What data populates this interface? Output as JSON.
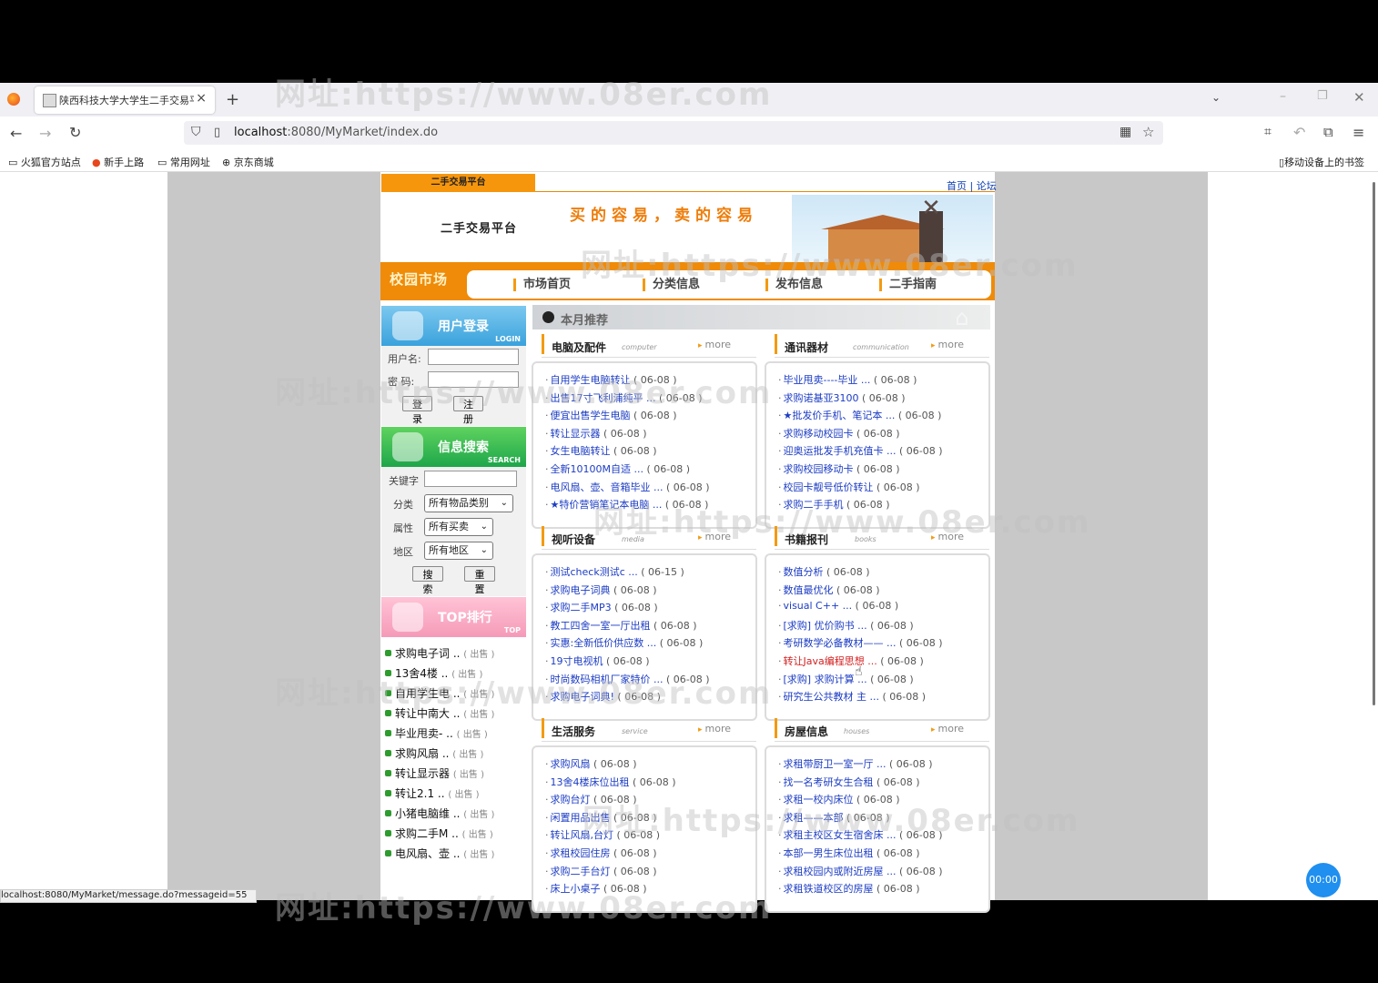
{
  "browser": {
    "tab_title": "陕西科技大学大学生二手交易平",
    "url_host": "localhost",
    "url_rest": ":8080/MyMarket/index.do",
    "bookmarks": [
      "火狐官方站点",
      "新手上路",
      "常用网址",
      "京东商城"
    ],
    "mobile_bookmarks": "移动设备上的书签",
    "status_url": "localhost:8080/MyMarket/message.do?messageid=55",
    "timer": "00:00"
  },
  "header": {
    "platform_tab": "二手交易平台",
    "links": "首页 | 论坛",
    "site_name": "二手交易平台",
    "slogan": "买的容易，卖的容易",
    "campus": "校园市场",
    "nav": [
      "市场首页",
      "分类信息",
      "发布信息",
      "二手指南"
    ]
  },
  "login": {
    "title": "用户登录",
    "en": "LOGIN",
    "username_label": "用户名:",
    "password_label": "密 码:",
    "login_btn": "登录",
    "register_btn": "注册"
  },
  "search": {
    "title": "信息搜索",
    "en": "SEARCH",
    "keyword_label": "关键字",
    "category_label": "分类",
    "category_value": "所有物品类别",
    "attr_label": "属性",
    "attr_value": "所有买卖",
    "region_label": "地区",
    "region_value": "所有地区",
    "search_btn": "搜索",
    "reset_btn": "重置"
  },
  "top": {
    "title": "TOP排行",
    "en": "TOP",
    "items": [
      {
        "name": "求购电子词 ..",
        "status": "( 出售 )"
      },
      {
        "name": "13舍4楼 ..",
        "status": "( 出售 )"
      },
      {
        "name": "自用学生电 ..",
        "status": "( 出售 )"
      },
      {
        "name": "转让中南大 ..",
        "status": "( 出售 )"
      },
      {
        "name": "毕业甩卖- ..",
        "status": "( 出售 )"
      },
      {
        "name": "求购风扇 ..",
        "status": "( 出售 )"
      },
      {
        "name": "转让显示器",
        "status": "( 出售 )"
      },
      {
        "name": "转让2.1 ..",
        "status": "( 出售 )"
      },
      {
        "name": "小猪电脑维 ..",
        "status": "( 出售 )"
      },
      {
        "name": "求购二手M ..",
        "status": "( 出售 )"
      },
      {
        "name": "电风扇、壶 ..",
        "status": "( 出售 )"
      }
    ]
  },
  "month": {
    "title": "本月推荐"
  },
  "categories": [
    {
      "zh": "电脑及配件",
      "en": "computer",
      "more": "more",
      "items": [
        {
          "t": "自用学生电脑转让",
          "d": "( 06-08 )"
        },
        {
          "t": "出售17寸飞利浦纯平 ...",
          "d": "( 06-08 )"
        },
        {
          "t": "便宜出售学生电脑",
          "d": "( 06-08 )"
        },
        {
          "t": "转让显示器",
          "d": "( 06-08 )"
        },
        {
          "t": "女生电脑转让",
          "d": "( 06-08 )"
        },
        {
          "t": "全新10100M自适 ...",
          "d": "( 06-08 )"
        },
        {
          "t": "电风扇、壶、音箱毕业 ...",
          "d": "( 06-08 )"
        },
        {
          "t": "★特价营销笔记本电脑 ...",
          "d": "( 06-08 )"
        }
      ]
    },
    {
      "zh": "通讯器材",
      "en": "communication",
      "more": "more",
      "items": [
        {
          "t": "毕业甩卖----毕业 ...",
          "d": "( 06-08 )"
        },
        {
          "t": "求购诺基亚3100",
          "d": "( 06-08 )"
        },
        {
          "t": "★批发价手机、笔记本 ...",
          "d": "( 06-08 )"
        },
        {
          "t": "求购移动校园卡",
          "d": "( 06-08 )"
        },
        {
          "t": "迎奥运批发手机充值卡 ...",
          "d": "( 06-08 )"
        },
        {
          "t": "求购校园移动卡",
          "d": "( 06-08 )"
        },
        {
          "t": "校园卡靓号低价转让",
          "d": "( 06-08 )"
        },
        {
          "t": "求购二手手机",
          "d": "( 06-08 )"
        }
      ]
    },
    {
      "zh": "视听设备",
      "en": "media",
      "more": "more",
      "items": [
        {
          "t": "测试check测试c ...",
          "d": "( 06-15 )"
        },
        {
          "t": "求购电子词典",
          "d": "( 06-08 )"
        },
        {
          "t": "求购二手MP3",
          "d": "( 06-08 )"
        },
        {
          "t": "教工四舍一室一厅出租",
          "d": "( 06-08 )"
        },
        {
          "t": "实惠:全新低价供应数 ...",
          "d": "( 06-08 )"
        },
        {
          "t": "19寸电视机",
          "d": "( 06-08 )"
        },
        {
          "t": "时尚数码相机厂家特价 ...",
          "d": "( 06-08 )"
        },
        {
          "t": "求购电子词典!",
          "d": "( 06-08 )"
        }
      ]
    },
    {
      "zh": "书籍报刊",
      "en": "books",
      "more": "more",
      "items": [
        {
          "t": "数值分析",
          "d": "( 06-08 )"
        },
        {
          "t": "数值最优化",
          "d": "( 06-08 )"
        },
        {
          "t": "visual C++ ...",
          "d": "( 06-08 )"
        },
        {
          "t": "[求购] 优价购书 ...",
          "d": "( 06-08 )"
        },
        {
          "t": "考研数学必备教材—— ...",
          "d": "( 06-08 )"
        },
        {
          "t": "转让Java编程思想 ...",
          "d": "( 06-08 )",
          "hot": true
        },
        {
          "t": "[求购] 求购计算 ...",
          "d": "( 06-08 )"
        },
        {
          "t": "研究生公共教材 主 ...",
          "d": "( 06-08 )"
        }
      ]
    },
    {
      "zh": "生活服务",
      "en": "service",
      "more": "more",
      "items": [
        {
          "t": "求购风扇",
          "d": "( 06-08 )"
        },
        {
          "t": "13舍4楼床位出租",
          "d": "( 06-08 )"
        },
        {
          "t": "求购台灯",
          "d": "( 06-08 )"
        },
        {
          "t": "闲置用品出售",
          "d": "( 06-08 )"
        },
        {
          "t": "转让风扇,台灯",
          "d": "( 06-08 )"
        },
        {
          "t": "求租校园住房",
          "d": "( 06-08 )"
        },
        {
          "t": "求购二手台灯",
          "d": "( 06-08 )"
        },
        {
          "t": "床上小桌子",
          "d": "( 06-08 )"
        }
      ]
    },
    {
      "zh": "房屋信息",
      "en": "houses",
      "more": "more",
      "items": [
        {
          "t": "求租带厨卫一室一厅 ...",
          "d": "( 06-08 )"
        },
        {
          "t": "找一名考研女生合租",
          "d": "( 06-08 )"
        },
        {
          "t": "求租一校内床位",
          "d": "( 06-08 )"
        },
        {
          "t": "求租——本部",
          "d": "( 06-08 )"
        },
        {
          "t": "求租主校区女生宿舍床 ...",
          "d": "( 06-08 )"
        },
        {
          "t": "本部一男生床位出租",
          "d": "( 06-08 )"
        },
        {
          "t": "求租校园内或附近房屋 ...",
          "d": "( 06-08 )"
        },
        {
          "t": "求租铁道校区的房屋",
          "d": "( 06-08 )"
        }
      ]
    }
  ],
  "watermark": "网址:https://www.08er.com"
}
